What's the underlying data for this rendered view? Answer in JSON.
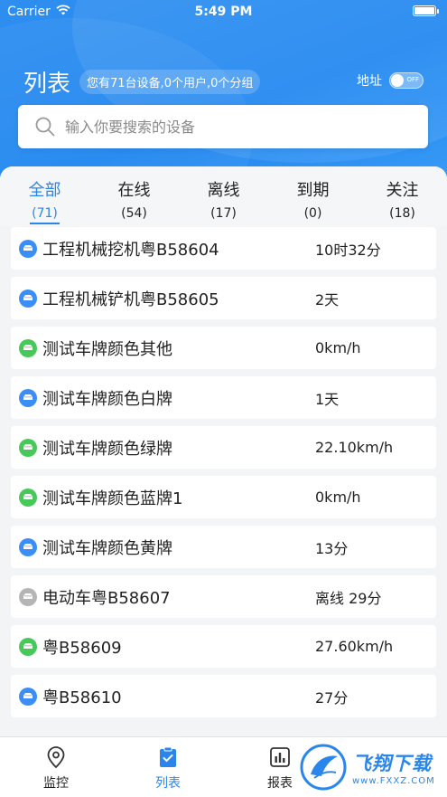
{
  "status_bar": {
    "carrier": "Carrier",
    "time": "5:49 PM"
  },
  "header": {
    "title": "列表",
    "summary": "您有71台设备,0个用户,0个分组",
    "address_label": "地址",
    "address_switch_text": "OFF",
    "address_switch_on": false
  },
  "search": {
    "placeholder": "输入你要搜索的设备",
    "value": ""
  },
  "tabs": [
    {
      "label": "全部",
      "count": "(71)",
      "active": true
    },
    {
      "label": "在线",
      "count": "(54)"
    },
    {
      "label": "离线",
      "count": "(17)"
    },
    {
      "label": "到期",
      "count": "(0)"
    },
    {
      "label": "关注",
      "count": "(18)"
    }
  ],
  "devices": [
    {
      "name": "工程机械挖机粤B58604",
      "status": "10时32分",
      "icon_color": "blue"
    },
    {
      "name": "工程机械铲机粤B58605",
      "status": "2天",
      "icon_color": "blue"
    },
    {
      "name": "测试车牌颜色其他",
      "status": "0km/h",
      "icon_color": "green"
    },
    {
      "name": "测试车牌颜色白牌",
      "status": "1天",
      "icon_color": "blue"
    },
    {
      "name": "测试车牌颜色绿牌",
      "status": "22.10km/h",
      "icon_color": "green"
    },
    {
      "name": "测试车牌颜色蓝牌1",
      "status": "0km/h",
      "icon_color": "green"
    },
    {
      "name": "测试车牌颜色黄牌",
      "status": "13分",
      "icon_color": "blue"
    },
    {
      "name": "电动车粤B58607",
      "status": "离线 29分",
      "icon_color": "gray"
    },
    {
      "name": "粤B58609",
      "status": "27.60km/h",
      "icon_color": "green"
    },
    {
      "name": "粤B58610",
      "status": "27分",
      "icon_color": "blue"
    }
  ],
  "bottom_nav": [
    {
      "label": "监控",
      "icon": "location-pin-icon"
    },
    {
      "label": "列表",
      "icon": "clipboard-list-icon",
      "active": true
    },
    {
      "label": "报表",
      "icon": "bar-chart-icon"
    }
  ],
  "watermark": {
    "text": "飞翔下载",
    "url": "www.FXXZ.COM"
  },
  "colors": {
    "accent": "#2a86ea",
    "online": "#47c95a",
    "offline": "#b5b5b5",
    "header": "#1f86f0"
  }
}
